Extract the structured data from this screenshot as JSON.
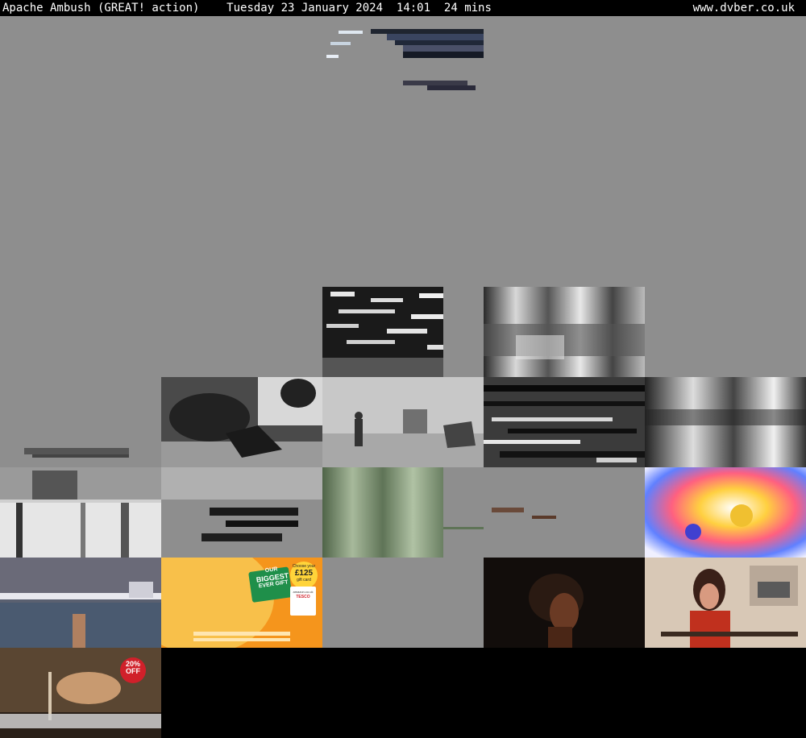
{
  "header": {
    "title": "Apache Ambush (GREAT! action)",
    "date": "Tuesday 23 January 2024",
    "time": "14:01",
    "duration": "24 mins",
    "site": "www.dvber.co.uk"
  },
  "ads": {
    "gift": {
      "line1": "OUR",
      "line2": "BIGGEST",
      "line3": "EVER GIFT",
      "choose": "Choose your",
      "amount": "£125",
      "card": "gift card",
      "store": "amazon.co.uk",
      "tesco": "TESCO"
    },
    "discount": {
      "pct": "20%",
      "off": "OFF"
    }
  }
}
